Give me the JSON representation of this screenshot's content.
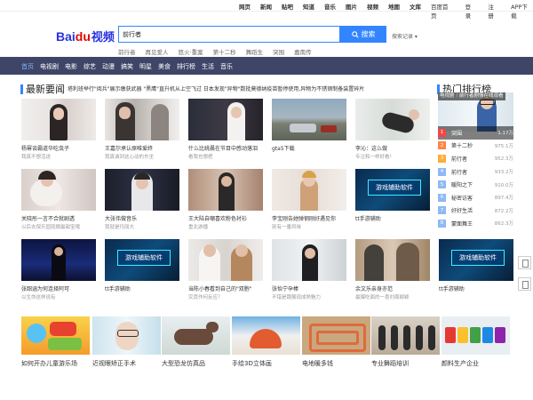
{
  "topnav": {
    "links": [
      "网页",
      "新闻",
      "贴吧",
      "知道",
      "音乐",
      "图片",
      "视频",
      "地图",
      "文库"
    ],
    "user": [
      "百度首页",
      "登录",
      "注册",
      "APP下载"
    ]
  },
  "logo": {
    "text_bai": "Bai",
    "text_du": "du",
    "text_video": "视频"
  },
  "search": {
    "value": "前行者",
    "button_label": "搜索",
    "history_label": "搜索记录"
  },
  "hot_keywords": [
    "前行者",
    "再见爱人",
    "怒火·重案",
    "第十二秒",
    "舞蹈生",
    "突围",
    "嘉南传"
  ],
  "categories": [
    "首页",
    "电视剧",
    "电影",
    "综艺",
    "动漫",
    "搞笑",
    "明星",
    "美食",
    "排行榜",
    "生活",
    "音乐"
  ],
  "news": {
    "title": "最新要闻",
    "marquee": "塔利班举行\"阅兵\"展示缴获武器 \"黑鹰\"直升机从上空飞过    日本发现\"异物\"数批莫德纳疫苗暂停使用,异物为不锈钢制备装置碎片",
    "cards": [
      {
        "t1": "杨幂谈霸道华吃虫子",
        "t2": "我真不想活送"
      },
      {
        "t1": "王嘉尔承认原唯爱终",
        "t2": "我真诚到这心动的东坐"
      },
      {
        "t1": "什么比姚晨在节目中感动落泪",
        "t2": "看我也想把"
      },
      {
        "t1": "gta5下载",
        "t2": ""
      },
      {
        "t1": "李沁：这么做",
        "t2": "专注和一样好看！"
      },
      {
        "t1": "关晓彤一言不合就剧透",
        "t2": "以后去保乐园就搁最甜宝哦"
      },
      {
        "t1": "大张伟做音乐",
        "t2": "我就是玛丽大"
      },
      {
        "t1": "王大陆自嘲喜欢粉色衬衫",
        "t2": "重北游播"
      },
      {
        "t1": "李宝刚告她弹钢刚好遇见你",
        "t2": "别有一番风味"
      },
      {
        "t1": "tt手游辅助",
        "t2": ""
      },
      {
        "t1": "张韶涵为何连择阿可",
        "t2": "以生命这样说有"
      },
      {
        "t1": "tt手游辅助",
        "t2": ""
      },
      {
        "t1": "当陈小春看到自己的\"双胞\"",
        "t2": "究竟作何反应？"
      },
      {
        "t1": "张怡宁孕棒",
        "t2": "不错是跟展现成熟魅力"
      },
      {
        "t1": "余文乐亲身亦范",
        "t2": "最爆吃面的一喜刘周颖颖"
      },
      {
        "t1": "tt手游辅助",
        "t2": ""
      }
    ],
    "game_banner": "游戏辅助软件"
  },
  "ranking": {
    "title": "热门排行榜",
    "highlight": "电视剧｜前行者剧情在线观看",
    "items": [
      {
        "n": "1",
        "title": "突围",
        "count": "1.17万"
      },
      {
        "n": "2",
        "title": "第十二秒",
        "count": "975.1万"
      },
      {
        "n": "3",
        "title": "前行者",
        "count": "952.3万"
      },
      {
        "n": "4",
        "title": "前行者",
        "count": "933.2万"
      },
      {
        "n": "5",
        "title": "暖阳之下",
        "count": "910.0万"
      },
      {
        "n": "6",
        "title": "秘密访客",
        "count": "897.4万"
      },
      {
        "n": "7",
        "title": "好好生活",
        "count": "872.2万"
      },
      {
        "n": "8",
        "title": "蒙面舞王",
        "count": "862.3万"
      }
    ]
  },
  "bottom": [
    {
      "title": "如何开办儿童游乐场"
    },
    {
      "title": "近视眼矫正手术"
    },
    {
      "title": "大型恐龙仿真品"
    },
    {
      "title": "手绘3D立体画"
    },
    {
      "title": "电地暖多钱"
    },
    {
      "title": "专业舞蹈培训"
    },
    {
      "title": "颜料生产企业"
    }
  ],
  "colors": {
    "accent": "#3385ff",
    "catbar": "#3f4567",
    "rank_top": "#f54545",
    "rank_mid": "#ff8547",
    "rank_low": "#ffac38"
  }
}
